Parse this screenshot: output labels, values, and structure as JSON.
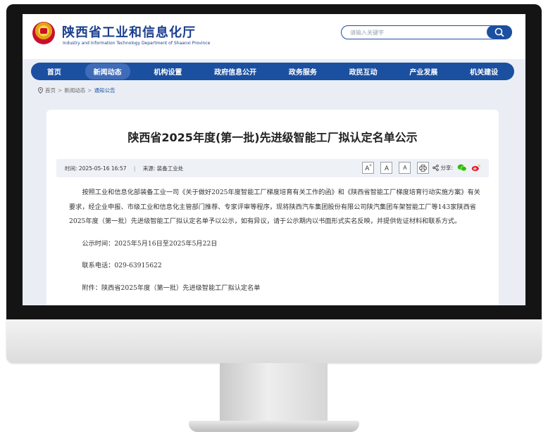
{
  "header": {
    "title": "陕西省工业和信息化厅",
    "subtitle": "Industry and Information Technology Department of Shaanxi Province"
  },
  "search": {
    "placeholder": "请输入关键字"
  },
  "nav": {
    "items": [
      "首页",
      "新闻动态",
      "机构设置",
      "政府信息公开",
      "政务服务",
      "政民互动",
      "产业发展",
      "机关建设"
    ],
    "active_index": 1
  },
  "breadcrumb": {
    "items": [
      "首页",
      "新闻动态",
      "通知公告"
    ],
    "separator": ">"
  },
  "article": {
    "title": "陕西省2025年度(第一批)先进级智能工厂拟认定名单公示",
    "time_label": "时间:",
    "time": "2025-05-16 16:57",
    "source_label": "来源:",
    "source": "装备工业处",
    "share_label": "分享:",
    "paragraphs": [
      "按照工业和信息化部装备工业一司《关于做好2025年度智能工厂梯度培育有关工作的函》和《陕西省智能工厂梯度培育行动实施方案》有关要求，经企业申报、市级工业和信息化主管部门推荐、专家评审等程序，现将陕西汽车集团股份有限公司陕汽集团车架智能工厂等143家陕西省2025年度（第一批）先进级智能工厂拟认定名单予以公示，如有异议，请于公示期内以书面形式实名反映，并提供佐证材料和联系方式。",
      "公示时间：2025年5月16日至2025年5月22日",
      "联系电话：029-63915622",
      "附件：陕西省2025年度（第一批）先进级智能工厂拟认定名单"
    ]
  },
  "tools": {
    "font_increase": "A",
    "font_normal": "A",
    "font_decrease": "A",
    "font_increase_mark": "+"
  },
  "icons": [
    "emblem-icon",
    "search-icon",
    "location-pin-icon",
    "print-icon",
    "share-icon",
    "wechat-icon",
    "weibo-icon"
  ],
  "colors": {
    "brand_blue": "#1b4fa0",
    "title_blue": "#1b3f8f",
    "page_bg": "#eaeef4"
  }
}
